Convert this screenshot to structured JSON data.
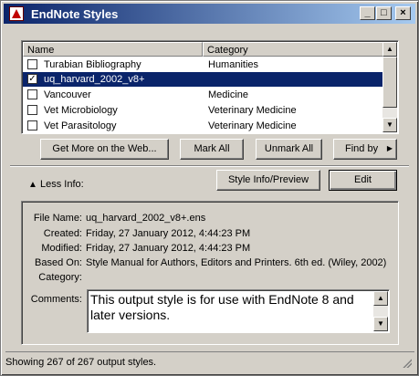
{
  "window": {
    "title": "EndNote Styles",
    "controls": {
      "minimize": "_",
      "maximize": "□",
      "close": "×"
    }
  },
  "list": {
    "columns": {
      "name": "Name",
      "category": "Category"
    },
    "rows": [
      {
        "name": "Turabian Bibliography",
        "category": "Humanities",
        "checked": false,
        "selected": false
      },
      {
        "name": "uq_harvard_2002_v8+",
        "category": "",
        "checked": true,
        "selected": true
      },
      {
        "name": "Vancouver",
        "category": "Medicine",
        "checked": false,
        "selected": false
      },
      {
        "name": "Vet Microbiology",
        "category": "Veterinary Medicine",
        "checked": false,
        "selected": false
      },
      {
        "name": "Vet Parasitology",
        "category": "Veterinary Medicine",
        "checked": false,
        "selected": false
      }
    ]
  },
  "actions": {
    "get_more": "Get More on the Web...",
    "mark_all": "Mark All",
    "unmark_all": "Unmark All",
    "find_by": "Find by"
  },
  "info": {
    "toggle_label": "Less Info:",
    "style_info_button": "Style Info/Preview",
    "edit_button": "Edit",
    "fields": {
      "file_name_label": "File Name:",
      "file_name": "uq_harvard_2002_v8+.ens",
      "created_label": "Created:",
      "created": "Friday, 27 January 2012, 4:44:23 PM",
      "modified_label": "Modified:",
      "modified": "Friday, 27 January 2012, 4:44:23 PM",
      "based_on_label": "Based On:",
      "based_on": "Style Manual for Authors, Editors and Printers. 6th ed. (Wiley, 2002)",
      "category_label": "Category:",
      "category": "",
      "comments_label": "Comments:",
      "comments": "This output style is for use with EndNote 8 and later versions."
    }
  },
  "status": {
    "text": "Showing 267 of 267 output styles."
  }
}
